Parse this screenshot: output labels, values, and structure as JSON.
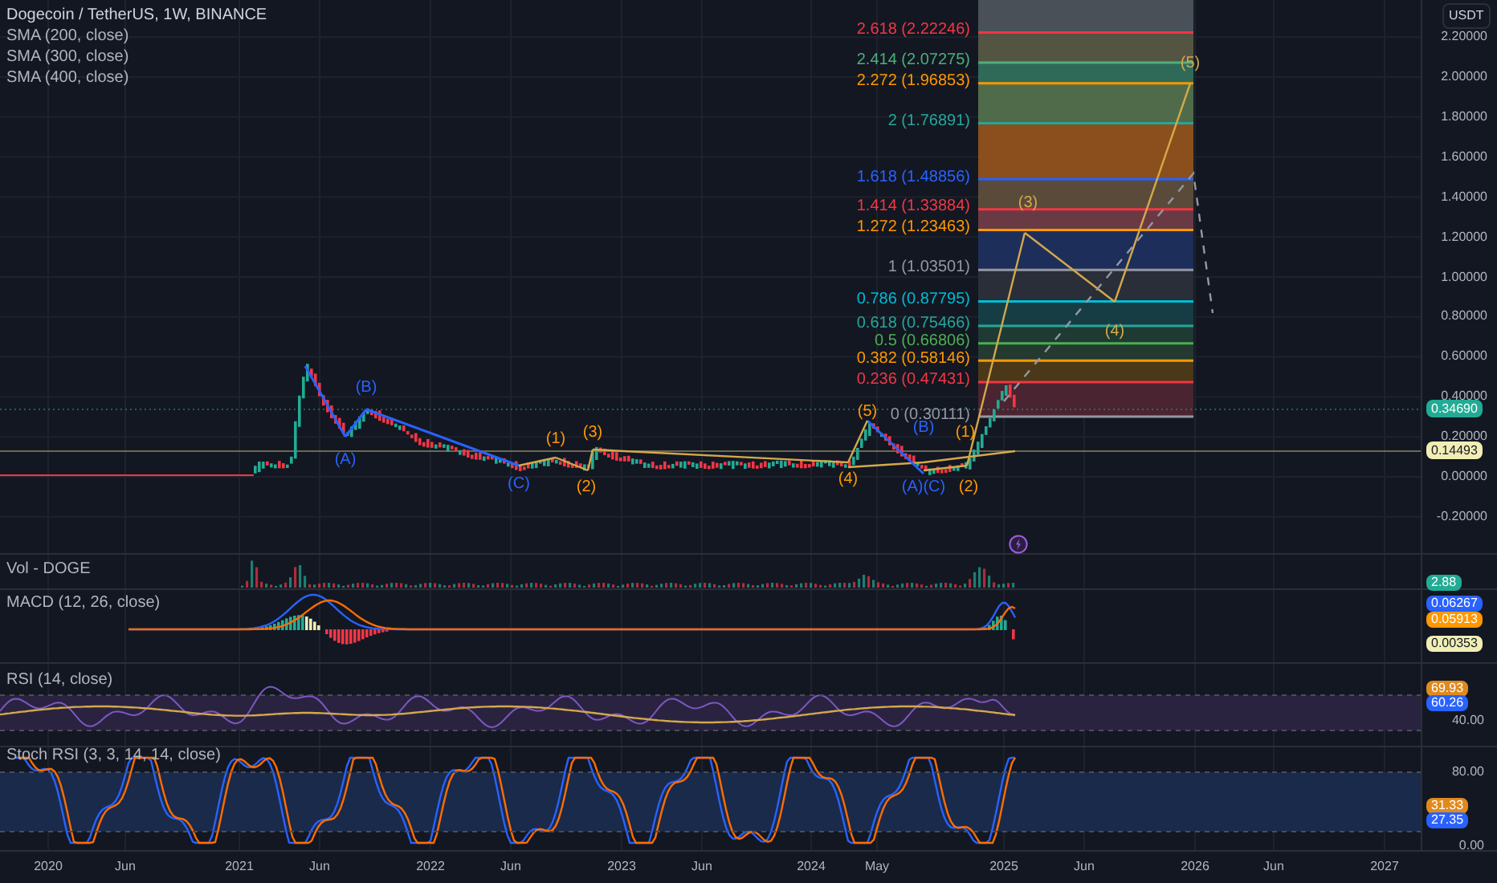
{
  "legend": {
    "title": "Dogecoin / TetherUS, 1W, BINANCE",
    "indicators": [
      "SMA (200, close)",
      "SMA (300, close)",
      "SMA (400, close)"
    ]
  },
  "price_axis": {
    "currency": "USDT",
    "ticks": [
      "2.20000",
      "2.00000",
      "1.80000",
      "1.60000",
      "1.40000",
      "1.20000",
      "1.00000",
      "0.80000",
      "0.60000",
      "0.40000",
      "0.20000",
      "0.00000",
      "-0.20000"
    ],
    "badges": [
      {
        "text": "0.34690",
        "color": "#22ab94"
      },
      {
        "text": "0.14493",
        "color": "#f0eeb4"
      }
    ]
  },
  "fib_levels": [
    {
      "label": "2.618 (2.22246)",
      "color": "#f23645"
    },
    {
      "label": "2.414 (2.07275)",
      "color": "#4caf7a"
    },
    {
      "label": "2.272 (1.96853)",
      "color": "#ff9800"
    },
    {
      "label": "2 (1.76891)",
      "color": "#26a69a"
    },
    {
      "label": "1.618 (1.48856)",
      "color": "#2962ff"
    },
    {
      "label": "1.414 (1.33884)",
      "color": "#f23645"
    },
    {
      "label": "1.272 (1.23463)",
      "color": "#ff9800"
    },
    {
      "label": "1 (1.03501)",
      "color": "#9598a1"
    },
    {
      "label": "0.786 (0.87795)",
      "color": "#00bcd4"
    },
    {
      "label": "0.618 (0.75466)",
      "color": "#26a69a"
    },
    {
      "label": "0.5 (0.66806)",
      "color": "#4caf50"
    },
    {
      "label": "0.382 (0.58146)",
      "color": "#ff9800"
    },
    {
      "label": "0.236 (0.47431)",
      "color": "#f23645"
    },
    {
      "label": "0 (0.30111)",
      "color": "#9598a1"
    }
  ],
  "wave_labels": [
    {
      "text": "(A)",
      "color": "#2962ff"
    },
    {
      "text": "(B)",
      "color": "#2962ff"
    },
    {
      "text": "(C)",
      "color": "#2962ff"
    },
    {
      "text": "(1)",
      "color": "#ff9800"
    },
    {
      "text": "(2)",
      "color": "#ff9800"
    },
    {
      "text": "(3)",
      "color": "#ff9800"
    },
    {
      "text": "(4)",
      "color": "#ff9800"
    },
    {
      "text": "(5)",
      "color": "#ff9800"
    },
    {
      "text": "(B)",
      "color": "#2962ff"
    },
    {
      "text": "(A)(C)",
      "color": "#2962ff"
    },
    {
      "text": "(1)",
      "color": "#ff9800"
    },
    {
      "text": "(2)",
      "color": "#ff9800"
    },
    {
      "text": "(3)",
      "color": "#d4a94a"
    },
    {
      "text": "(4)",
      "color": "#d4a94a"
    },
    {
      "text": "(5)",
      "color": "#d4a94a"
    }
  ],
  "panels": [
    {
      "kind": "volume",
      "title": "Vol - DOGE",
      "badges": [
        {
          "text": "2.88",
          "color": "#22ab94"
        }
      ]
    },
    {
      "kind": "macd",
      "title": "MACD (12, 26, close)",
      "badges": [
        {
          "text": "0.06267",
          "color": "#2962ff"
        },
        {
          "text": "0.05913",
          "color": "#ff9800"
        },
        {
          "text": "0.00353",
          "color": "#f0eeb4"
        }
      ]
    },
    {
      "kind": "rsi",
      "title": "RSI (14, close)",
      "badges": [
        {
          "text": "69.93",
          "color": "#e08a1e"
        },
        {
          "text": "60.26",
          "color": "#2962ff"
        }
      ],
      "ticks": [
        "40.00"
      ]
    },
    {
      "kind": "stoch",
      "title": "Stoch RSI (3, 3, 14, 14, close)",
      "badges": [
        {
          "text": "31.33",
          "color": "#e08a1e"
        },
        {
          "text": "27.35",
          "color": "#2962ff"
        }
      ],
      "ticks": [
        "80.00",
        "0.00"
      ]
    }
  ],
  "time_axis": [
    "2020",
    "Jun",
    "2021",
    "Jun",
    "2022",
    "Jun",
    "2023",
    "Jun",
    "2024",
    "May",
    "2025",
    "Jun",
    "2026",
    "Jun",
    "2027"
  ]
}
